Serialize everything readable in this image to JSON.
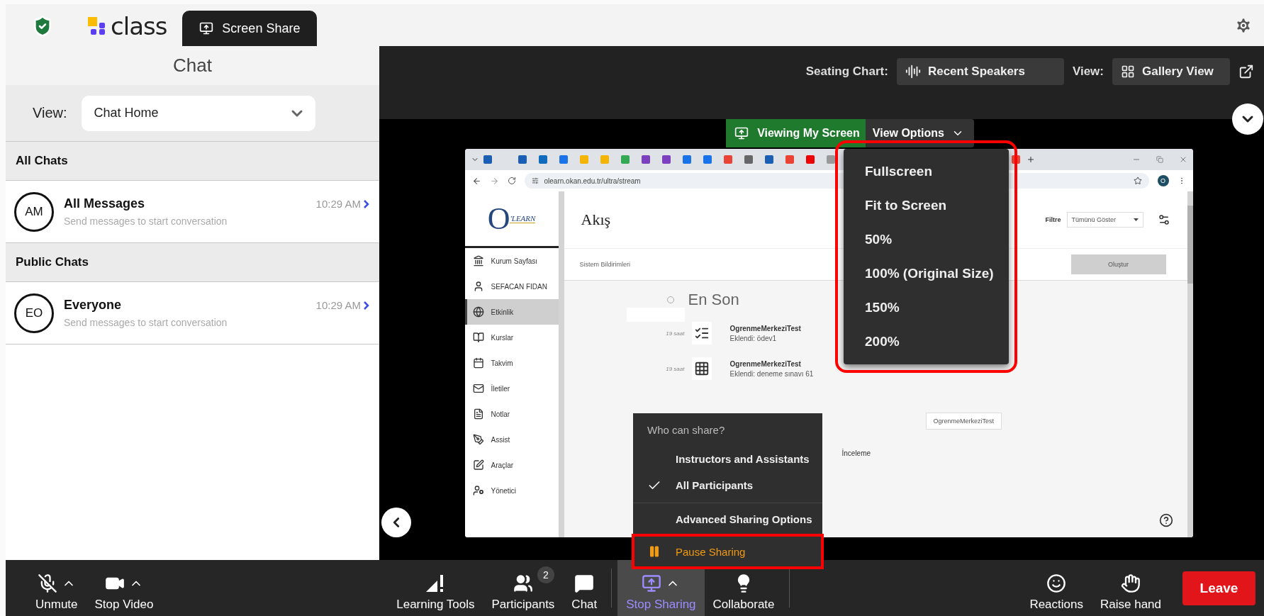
{
  "header": {
    "logo_text": "class",
    "tab": {
      "label": "Screen Share",
      "selected": true
    }
  },
  "chat_panel": {
    "title": "Chat",
    "view_label": "View:",
    "view_value": "Chat Home",
    "sections": [
      {
        "title": "All Chats",
        "chats": [
          {
            "initials": "AM",
            "name": "All Messages",
            "time": "10:29 AM",
            "preview": "Send messages to start conversation"
          }
        ]
      },
      {
        "title": "Public Chats",
        "chats": [
          {
            "initials": "EO",
            "name": "Everyone",
            "time": "10:29 AM",
            "preview": "Send messages to start conversation"
          }
        ]
      }
    ]
  },
  "stage": {
    "seating_label": "Seating Chart:",
    "seating_value": "Recent Speakers",
    "view_label": "View:",
    "view_value": "Gallery View",
    "viewing_badge": "Viewing My Screen",
    "view_options": "View Options",
    "view_options_menu": [
      "Fullscreen",
      "Fit to Screen",
      "50%",
      "100% (Original Size)",
      "150%",
      "200%"
    ]
  },
  "shared_screen": {
    "url": "olearn.okan.edu.tr/ultra/stream",
    "account_initial": "O",
    "logo_letter": "O",
    "logo_text": "'LEARN",
    "page_title": "Akış",
    "filter_label": "Filtre",
    "filter_value": "Tümünü Göster",
    "notice": "Sistem Bildirimleri",
    "create_button": "Oluştur",
    "nav": [
      {
        "label": "Kurum Sayfası",
        "selected": false
      },
      {
        "label": "SEFACAN FIDAN",
        "selected": false
      },
      {
        "label": "Etkinlik",
        "selected": true
      },
      {
        "label": "Kurslar",
        "selected": false
      },
      {
        "label": "Takvim",
        "selected": false
      },
      {
        "label": "İletiler",
        "selected": false
      },
      {
        "label": "Notlar",
        "selected": false
      },
      {
        "label": "Assist",
        "selected": false
      },
      {
        "label": "Araçlar",
        "selected": false
      },
      {
        "label": "Yönetici",
        "selected": false
      }
    ],
    "timeline_heading": "En Son",
    "events": [
      {
        "time": "19 saat",
        "title": "OgrenmeMerkeziTest",
        "detail": "Eklendi: ödev1",
        "kind": "assignment"
      },
      {
        "time": "19 saat",
        "title": "OgrenmeMerkeziTest",
        "detail": "Eklendi: deneme sınavı 61",
        "kind": "test"
      }
    ],
    "partial_text": "İnceleme",
    "tooltip": "OgrenmeMerkeziTest"
  },
  "share_menu": {
    "heading": "Who can share?",
    "options": [
      {
        "label": "Instructors and Assistants",
        "selected": false
      },
      {
        "label": "All Participants",
        "selected": true
      }
    ],
    "advanced": "Advanced Sharing Options",
    "pause": "Pause Sharing"
  },
  "toolbar": {
    "left": [
      {
        "label": "Unmute",
        "kind": "mic",
        "caret": true
      },
      {
        "label": "Stop Video",
        "kind": "video",
        "caret": true
      }
    ],
    "center": [
      {
        "label": "Learning Tools",
        "kind": "tools",
        "caret": false,
        "active": false
      },
      {
        "label": "Participants",
        "kind": "people",
        "caret": false,
        "active": false,
        "badge": "2"
      },
      {
        "label": "Chat",
        "kind": "chat",
        "caret": false,
        "active": false
      },
      {
        "label": "Stop Sharing",
        "kind": "share",
        "caret": true,
        "active": true
      },
      {
        "label": "Collaborate",
        "kind": "bulb",
        "caret": false,
        "active": false
      }
    ],
    "right": [
      {
        "label": "Reactions",
        "kind": "reactions",
        "caret": false
      },
      {
        "label": "Raise hand",
        "kind": "hand",
        "caret": false
      }
    ],
    "leave": "Leave"
  }
}
